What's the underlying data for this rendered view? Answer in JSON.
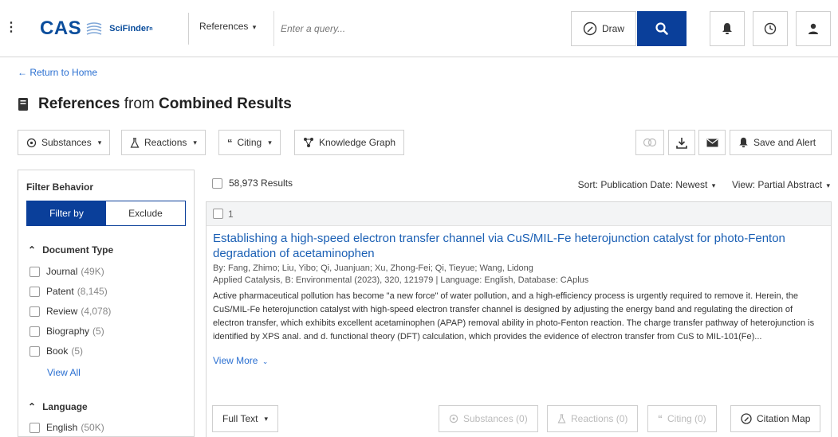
{
  "header": {
    "logo_text": "CAS",
    "product": "SciFinder",
    "search_type": "References",
    "query_placeholder": "Enter a query...",
    "draw_label": "Draw"
  },
  "nav": {
    "return_label": "← Return to Home"
  },
  "page": {
    "title_prefix": "References",
    "title_mid": " from ",
    "title_suffix": "Combined Results"
  },
  "toolbar": {
    "substances": "Substances",
    "reactions": "Reactions",
    "citing": "Citing",
    "knowledge_graph": "Knowledge Graph",
    "save_alert": "Save and Alert"
  },
  "sidebar": {
    "filter_behavior": "Filter Behavior",
    "filter_by": "Filter by",
    "exclude": "Exclude",
    "document_type": "Document Type",
    "doc_types": [
      {
        "label": "Journal",
        "count": "(49K)"
      },
      {
        "label": "Patent",
        "count": "(8,145)"
      },
      {
        "label": "Review",
        "count": "(4,078)"
      },
      {
        "label": "Biography",
        "count": "(5)"
      },
      {
        "label": "Book",
        "count": "(5)"
      }
    ],
    "view_all": "View All",
    "language": "Language",
    "languages": [
      {
        "label": "English",
        "count": "(50K)"
      }
    ]
  },
  "results": {
    "count": "58,973 Results",
    "sort": "Sort: Publication Date: Newest",
    "view": "View: Partial Abstract",
    "item": {
      "index": "1",
      "title": "Establishing a high-speed electron transfer channel via CuS/MIL-Fe heterojunction catalyst for photo-Fenton degradation of acetaminophen",
      "authors": "By: Fang, Zhimo; Liu, Yibo; Qi, Juanjuan; Xu, Zhong-Fei; Qi, Tieyue; Wang, Lidong",
      "source": "Applied Catalysis, B: Environmental (2023), 320, 121979 | Language: English, Database: CAplus",
      "abstract": "Active pharmaceutical pollution has become \"a new force\" of water pollution, and a high-efficiency process is urgently required to remove it. Herein, the CuS/MIL-Fe heterojunction catalyst with high-speed electron transfer channel is designed by adjusting the energy band and regulating the direction of electron transfer, which exhibits excellent acetaminophen (APAP) removal ability in photo-Fenton reaction. The charge transfer pathway of heterojunction is identified by XPS anal. and d. functional theory (DFT) calculation, which provides the evidence of electron transfer from CuS to MIL-101(Fe)...",
      "view_more": "View More",
      "full_text": "Full Text",
      "substances": "Substances (0)",
      "reactions": "Reactions (0)",
      "citing": "Citing (0)",
      "citation_map": "Citation Map"
    }
  },
  "colors": {
    "brand": "#0a3f9a",
    "link": "#2a6fd1",
    "title": "#1a5fb4"
  }
}
